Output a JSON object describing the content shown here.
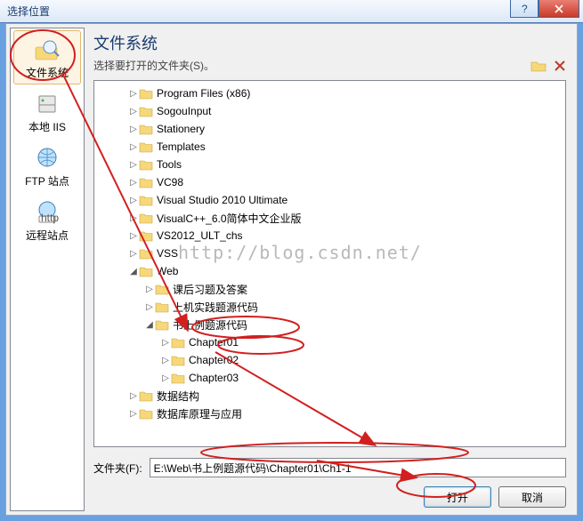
{
  "window": {
    "title": "选择位置",
    "close": "X",
    "help": "?"
  },
  "sidebar": {
    "items": [
      {
        "label": "文件系统"
      },
      {
        "label": "本地 IIS"
      },
      {
        "label": "FTP 站点"
      },
      {
        "label": "远程站点"
      }
    ]
  },
  "main": {
    "heading": "文件系统",
    "subheading": "选择要打开的文件夹(S)。"
  },
  "tree": {
    "items": [
      {
        "depth": 2,
        "expander": "▷",
        "label": "Program Files (x86)"
      },
      {
        "depth": 2,
        "expander": "▷",
        "label": "SogouInput"
      },
      {
        "depth": 2,
        "expander": "▷",
        "label": "Stationery"
      },
      {
        "depth": 2,
        "expander": "▷",
        "label": "Templates"
      },
      {
        "depth": 2,
        "expander": "▷",
        "label": "Tools"
      },
      {
        "depth": 2,
        "expander": "▷",
        "label": "VC98"
      },
      {
        "depth": 2,
        "expander": "▷",
        "label": "Visual Studio 2010 Ultimate"
      },
      {
        "depth": 2,
        "expander": "▷",
        "label": "VisualC++_6.0简体中文企业版"
      },
      {
        "depth": 2,
        "expander": "▷",
        "label": "VS2012_ULT_chs"
      },
      {
        "depth": 2,
        "expander": "▷",
        "label": "VSS"
      },
      {
        "depth": 2,
        "expander": "◢",
        "label": "Web"
      },
      {
        "depth": 3,
        "expander": "▷",
        "label": "课后习题及答案"
      },
      {
        "depth": 3,
        "expander": "▷",
        "label": "上机实践题源代码"
      },
      {
        "depth": 3,
        "expander": "◢",
        "label": "书上例题源代码"
      },
      {
        "depth": 4,
        "expander": "▷",
        "label": "Chapter01"
      },
      {
        "depth": 4,
        "expander": "▷",
        "label": "Chapter02"
      },
      {
        "depth": 4,
        "expander": "▷",
        "label": "Chapter03"
      },
      {
        "depth": 2,
        "expander": "▷",
        "label": "数据结构"
      },
      {
        "depth": 2,
        "expander": "▷",
        "label": "数据库原理与应用"
      }
    ]
  },
  "path": {
    "label": "文件夹(F):",
    "value": "E:\\Web\\书上例题源代码\\Chapter01\\Ch1-1"
  },
  "buttons": {
    "open": "打开",
    "cancel": "取消"
  },
  "watermark": "http://blog.csdn.net/",
  "colors": {
    "accent": "#3c7fb1",
    "annot": "#d21f1f"
  }
}
